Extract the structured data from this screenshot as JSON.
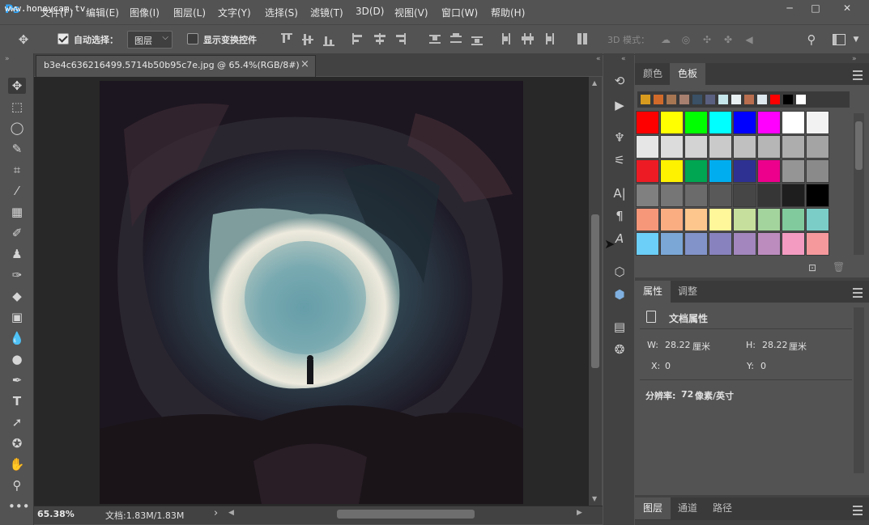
{
  "app": {
    "logo": "Ps",
    "watermark": "www.honeycam.tv"
  },
  "menu": [
    "文件(F)",
    "编辑(E)",
    "图像(I)",
    "图层(L)",
    "文字(Y)",
    "选择(S)",
    "滤镜(T)",
    "3D(D)",
    "视图(V)",
    "窗口(W)",
    "帮助(H)"
  ],
  "window_controls": {
    "minimize": "─",
    "restore": "□",
    "close": "✕"
  },
  "options": {
    "auto_select_label": "自动选择：",
    "auto_select_value": "图层",
    "show_transform_label": "显示变换控件",
    "mode_3d_label": "3D 模式："
  },
  "document": {
    "tab_title": "b3e4c636216499.5714b50b95c7e.jpg @ 65.4%(RGB/8#)",
    "close": "×",
    "zoom": "65.38%",
    "doc_info": "文档:1.83M/1.83M",
    "status_arrow": "›"
  },
  "color_panel": {
    "tabs": [
      "颜色",
      "色板"
    ],
    "active_tab": 1,
    "recent": [
      "#d99b1e",
      "#d06a2a",
      "#a67653",
      "#a78070",
      "#3a5166",
      "#5a6080",
      "#c5e6eb",
      "#e8f0f2",
      "#b86e4f",
      "#dde8ee",
      "#ff0000",
      "#000000",
      "#ffffff"
    ],
    "swatches": [
      [
        "#ff0000",
        "#ffff00",
        "#00ff00",
        "#00ffff",
        "#0000ff",
        "#ff00ff",
        "#ffffff",
        "#f2f2f2"
      ],
      [
        "#e6e6e6",
        "#dcdcdc",
        "#d3d3d3",
        "#cacaca",
        "#c0c0c0",
        "#b6b6b6",
        "#adadad",
        "#a4a4a4"
      ],
      [
        "#ed1c24",
        "#fff200",
        "#00a651",
        "#00aeef",
        "#2e3192",
        "#ec008c",
        "#959595",
        "#8a8a8a"
      ],
      [
        "#808080",
        "#767676",
        "#6b6b6b",
        "#595959",
        "#464646",
        "#363636",
        "#1e1e1e",
        "#000000"
      ],
      [
        "#f7977a",
        "#fbad82",
        "#fdc68c",
        "#fff799",
        "#c6df9c",
        "#a4d49d",
        "#81ca9d",
        "#7bcdc8"
      ],
      [
        "#6ccff7",
        "#7ba7d7",
        "#8293ca",
        "#8882be",
        "#a286bd",
        "#bc8cbf",
        "#f49bc1",
        "#f5999d"
      ]
    ]
  },
  "properties_panel": {
    "tabs": [
      "属性",
      "调整"
    ],
    "title": "文档属性",
    "w_label": "W:",
    "w_value": "28.22",
    "w_unit": "厘米",
    "h_label": "H:",
    "h_value": "28.22",
    "h_unit": "厘米",
    "x_label": "X:",
    "x_value": "0",
    "y_label": "Y:",
    "y_value": "0",
    "resolution_label": "分辨率:",
    "resolution_value": "72",
    "resolution_unit": "像素/英寸"
  },
  "layers_panel": {
    "tabs": [
      "图层",
      "通道",
      "路径"
    ]
  }
}
